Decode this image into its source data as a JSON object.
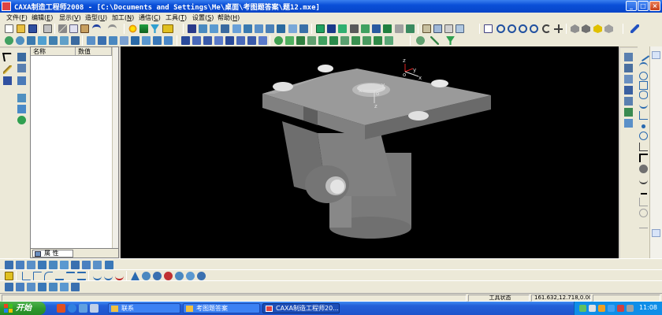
{
  "window": {
    "title": "CAXA制造工程师2008  - [C:\\Documents and Settings\\Me\\桌面\\考图题答案\\题12.mxe]",
    "controls": [
      "_",
      "□",
      "×"
    ]
  },
  "menu": [
    {
      "label": "文件",
      "key": "F"
    },
    {
      "label": "编辑",
      "key": "E"
    },
    {
      "label": "显示",
      "key": "V"
    },
    {
      "label": "造型",
      "key": "U"
    },
    {
      "label": "加工",
      "key": "N"
    },
    {
      "label": "通信",
      "key": "C"
    },
    {
      "label": "工具",
      "key": "T"
    },
    {
      "label": "设置",
      "key": "S"
    },
    {
      "label": "帮助",
      "key": "H"
    }
  ],
  "properties_panel": {
    "columns": [
      "名称",
      "数值"
    ],
    "tab_label": "属 性"
  },
  "viewport": {
    "axis_labels": {
      "z": "z",
      "y": "y",
      "x": "x",
      "origin": "o"
    }
  },
  "status": {
    "mode": "工具状态",
    "coordinates": "161.632,12.718,0.000"
  },
  "taskbar": {
    "start_label": "开始",
    "windows": [
      {
        "label": "联系",
        "active": false
      },
      {
        "label": "考图题答案",
        "active": false
      },
      {
        "label": "CAXA制造工程师20...",
        "active": true
      }
    ],
    "clock": "11:08"
  },
  "colors": {
    "titlebar": "#0745c8",
    "viewport_bg": "#000000",
    "part_gray": "#8a8a8a",
    "taskbar": "#2460d8",
    "start_green": "#2f9a2f"
  }
}
